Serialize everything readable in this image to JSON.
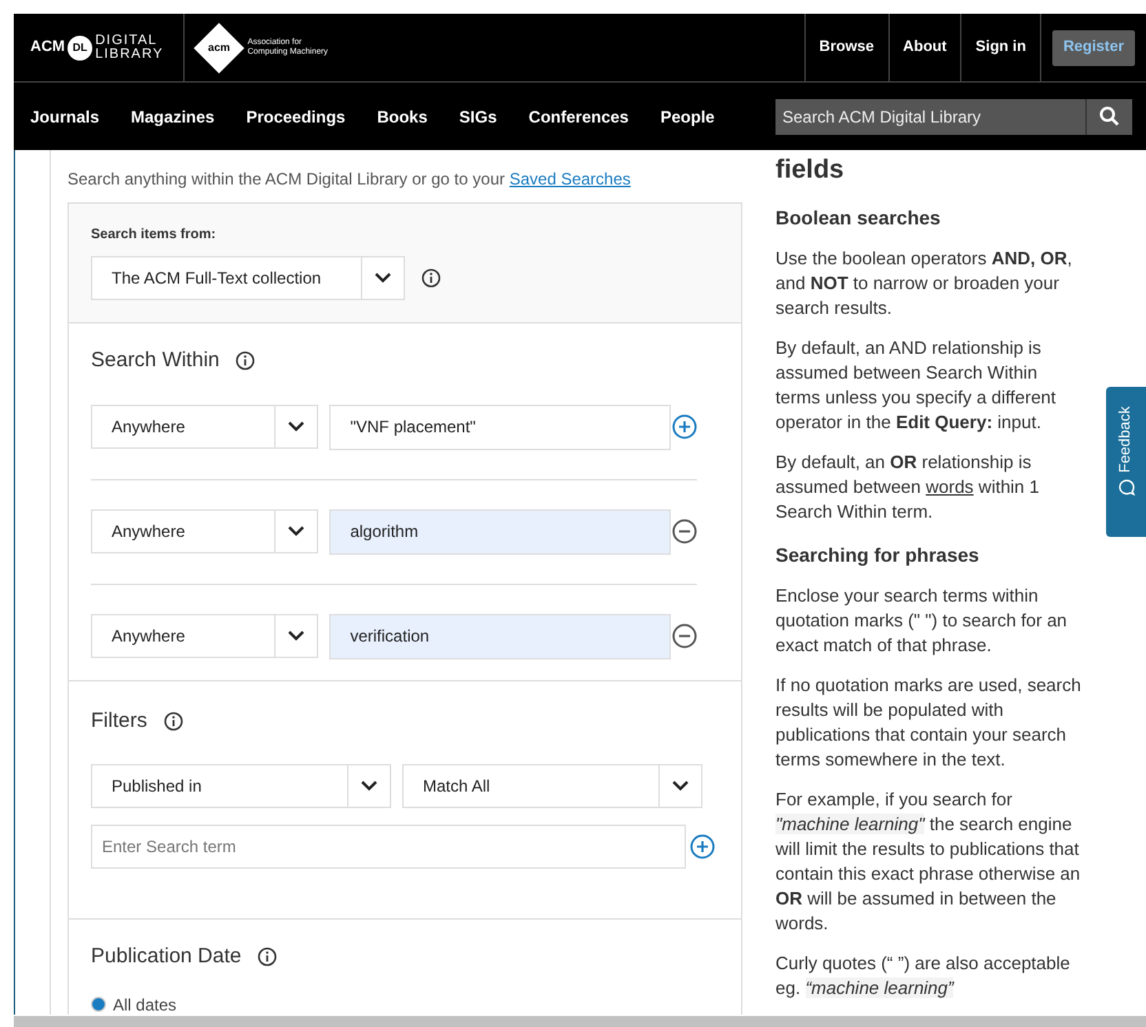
{
  "header": {
    "logo": {
      "acm": "ACM",
      "dl": "DL",
      "digital": "DIGITAL",
      "library": "LIBRARY"
    },
    "org_logo": {
      "badge": "acm",
      "line1": "Association for",
      "line2": "Computing Machinery"
    },
    "links": [
      "Browse",
      "About",
      "Sign in"
    ],
    "register": "Register",
    "nav": [
      "Journals",
      "Magazines",
      "Proceedings",
      "Books",
      "SIGs",
      "Conferences",
      "People"
    ],
    "search": {
      "placeholder": "Search ACM Digital Library"
    }
  },
  "intro": {
    "text": "Search anything within the ACM Digital Library or go to your",
    "link": "Saved Searches"
  },
  "search_items_from": {
    "label": "Search items from:",
    "value": "The ACM Full-Text collection"
  },
  "search_within": {
    "title": "Search Within",
    "rows": [
      {
        "field": "Anywhere",
        "term": "\"VNF placement\"",
        "kind": "add",
        "autofilled": false
      },
      {
        "field": "Anywhere",
        "term": "algorithm",
        "kind": "remove",
        "autofilled": true
      },
      {
        "field": "Anywhere",
        "term": "verification",
        "kind": "remove",
        "autofilled": true
      }
    ]
  },
  "filters": {
    "title": "Filters",
    "field": "Published in",
    "match": "Match All",
    "placeholder": "Enter Search term"
  },
  "publication_date": {
    "title": "Publication Date",
    "options": [
      {
        "label": "All dates",
        "selected": true
      }
    ]
  },
  "help": {
    "heading": "fields",
    "sections": [
      {
        "title": "Boolean searches",
        "paragraphs": [
          [
            {
              "kind": "plain",
              "text": "Use the boolean operators "
            },
            {
              "kind": "bold",
              "text": "AND, OR"
            },
            {
              "kind": "plain",
              "text": ", and "
            },
            {
              "kind": "bold",
              "text": "NOT"
            },
            {
              "kind": "plain",
              "text": " to narrow or broaden your search results."
            }
          ],
          [
            {
              "kind": "plain",
              "text": "By default, an AND relationship is assumed between Search Within terms unless you specify a different operator in the "
            },
            {
              "kind": "bold",
              "text": "Edit Query:"
            },
            {
              "kind": "plain",
              "text": " input."
            }
          ],
          [
            {
              "kind": "plain",
              "text": "By default, an "
            },
            {
              "kind": "bold",
              "text": "OR"
            },
            {
              "kind": "plain",
              "text": " relationship is assumed between "
            },
            {
              "kind": "underline",
              "text": "words"
            },
            {
              "kind": "plain",
              "text": " within 1 Search Within term."
            }
          ]
        ]
      },
      {
        "title": "Searching for phrases",
        "paragraphs": [
          [
            {
              "kind": "plain",
              "text": "Enclose your search terms within quotation marks (\" \") to search for an exact match of that phrase."
            }
          ],
          [
            {
              "kind": "plain",
              "text": "If no quotation marks are used, search results will be populated with publications that contain your search terms somewhere in the text."
            }
          ],
          [
            {
              "kind": "plain",
              "text": "For example, if you search for "
            },
            {
              "kind": "italic",
              "text": "\"machine learning\""
            },
            {
              "kind": "plain",
              "text": " the search engine will limit the results to publications that contain this exact phrase otherwise an "
            },
            {
              "kind": "bold",
              "text": "OR"
            },
            {
              "kind": "plain",
              "text": " will be assumed in between the words."
            }
          ],
          [
            {
              "kind": "plain",
              "text": "Curly quotes (“ ”) are also acceptable eg. "
            },
            {
              "kind": "italic",
              "text": "“machine learning”"
            }
          ]
        ]
      }
    ]
  },
  "feedback": "Feedback"
}
